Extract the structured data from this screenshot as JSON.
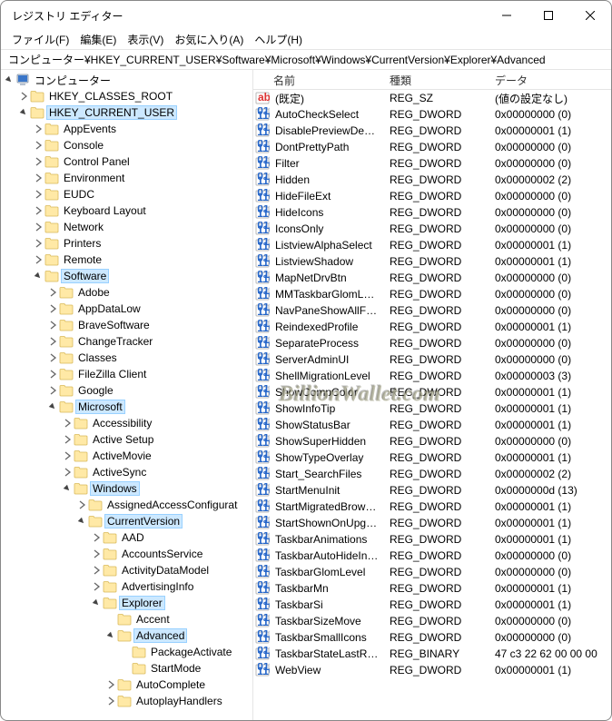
{
  "window": {
    "title": "レジストリ エディター"
  },
  "menu": {
    "file": "ファイル(F)",
    "edit": "編集(E)",
    "view": "表示(V)",
    "favorites": "お気に入り(A)",
    "help": "ヘルプ(H)"
  },
  "address": {
    "path": "コンピューター¥HKEY_CURRENT_USER¥Software¥Microsoft¥Windows¥CurrentVersion¥Explorer¥Advanced"
  },
  "tree": [
    {
      "depth": 0,
      "exp": "open",
      "icon": "computer",
      "label": "コンピューター",
      "sel": false
    },
    {
      "depth": 1,
      "exp": "closed",
      "icon": "folder",
      "label": "HKEY_CLASSES_ROOT",
      "sel": false
    },
    {
      "depth": 1,
      "exp": "open",
      "icon": "folder",
      "label": "HKEY_CURRENT_USER",
      "sel": true
    },
    {
      "depth": 2,
      "exp": "closed",
      "icon": "folder",
      "label": "AppEvents",
      "sel": false
    },
    {
      "depth": 2,
      "exp": "closed",
      "icon": "folder",
      "label": "Console",
      "sel": false
    },
    {
      "depth": 2,
      "exp": "closed",
      "icon": "folder",
      "label": "Control Panel",
      "sel": false
    },
    {
      "depth": 2,
      "exp": "closed",
      "icon": "folder",
      "label": "Environment",
      "sel": false
    },
    {
      "depth": 2,
      "exp": "closed",
      "icon": "folder",
      "label": "EUDC",
      "sel": false
    },
    {
      "depth": 2,
      "exp": "closed",
      "icon": "folder",
      "label": "Keyboard Layout",
      "sel": false
    },
    {
      "depth": 2,
      "exp": "closed",
      "icon": "folder",
      "label": "Network",
      "sel": false
    },
    {
      "depth": 2,
      "exp": "closed",
      "icon": "folder",
      "label": "Printers",
      "sel": false
    },
    {
      "depth": 2,
      "exp": "closed",
      "icon": "folder",
      "label": "Remote",
      "sel": false
    },
    {
      "depth": 2,
      "exp": "open",
      "icon": "folder-open",
      "label": "Software",
      "sel": true
    },
    {
      "depth": 3,
      "exp": "closed",
      "icon": "folder",
      "label": "Adobe",
      "sel": false
    },
    {
      "depth": 3,
      "exp": "closed",
      "icon": "folder",
      "label": "AppDataLow",
      "sel": false
    },
    {
      "depth": 3,
      "exp": "closed",
      "icon": "folder",
      "label": "BraveSoftware",
      "sel": false
    },
    {
      "depth": 3,
      "exp": "closed",
      "icon": "folder",
      "label": "ChangeTracker",
      "sel": false
    },
    {
      "depth": 3,
      "exp": "closed",
      "icon": "folder",
      "label": "Classes",
      "sel": false
    },
    {
      "depth": 3,
      "exp": "closed",
      "icon": "folder",
      "label": "FileZilla Client",
      "sel": false
    },
    {
      "depth": 3,
      "exp": "closed",
      "icon": "folder",
      "label": "Google",
      "sel": false
    },
    {
      "depth": 3,
      "exp": "open",
      "icon": "folder-open",
      "label": "Microsoft",
      "sel": true
    },
    {
      "depth": 4,
      "exp": "closed",
      "icon": "folder",
      "label": "Accessibility",
      "sel": false
    },
    {
      "depth": 4,
      "exp": "closed",
      "icon": "folder",
      "label": "Active Setup",
      "sel": false
    },
    {
      "depth": 4,
      "exp": "closed",
      "icon": "folder",
      "label": "ActiveMovie",
      "sel": false
    },
    {
      "depth": 4,
      "exp": "closed",
      "icon": "folder",
      "label": "ActiveSync",
      "sel": false
    },
    {
      "depth": 4,
      "exp": "open",
      "icon": "folder-open",
      "label": "Windows",
      "sel": true
    },
    {
      "depth": 5,
      "exp": "closed",
      "icon": "folder",
      "label": "AssignedAccessConfigurat",
      "sel": false
    },
    {
      "depth": 5,
      "exp": "open",
      "icon": "folder-open",
      "label": "CurrentVersion",
      "sel": true
    },
    {
      "depth": 6,
      "exp": "closed",
      "icon": "folder",
      "label": "AAD",
      "sel": false
    },
    {
      "depth": 6,
      "exp": "closed",
      "icon": "folder",
      "label": "AccountsService",
      "sel": false
    },
    {
      "depth": 6,
      "exp": "closed",
      "icon": "folder",
      "label": "ActivityDataModel",
      "sel": false
    },
    {
      "depth": 6,
      "exp": "closed",
      "icon": "folder",
      "label": "AdvertisingInfo",
      "sel": false
    },
    {
      "depth": 6,
      "exp": "open",
      "icon": "folder-open",
      "label": "Explorer",
      "sel": true
    },
    {
      "depth": 7,
      "exp": "none",
      "icon": "folder",
      "label": "Accent",
      "sel": false
    },
    {
      "depth": 7,
      "exp": "open",
      "icon": "folder-open",
      "label": "Advanced",
      "sel": true
    },
    {
      "depth": 8,
      "exp": "none",
      "icon": "folder",
      "label": "PackageActivate",
      "sel": false
    },
    {
      "depth": 8,
      "exp": "none",
      "icon": "folder",
      "label": "StartMode",
      "sel": false
    },
    {
      "depth": 7,
      "exp": "closed",
      "icon": "folder",
      "label": "AutoComplete",
      "sel": false
    },
    {
      "depth": 7,
      "exp": "closed",
      "icon": "folder",
      "label": "AutoplayHandlers",
      "sel": false
    }
  ],
  "columns": {
    "name": "名前",
    "type": "種類",
    "data": "データ"
  },
  "values": [
    {
      "icon": "str",
      "name": "(既定)",
      "type": "REG_SZ",
      "data": "(値の設定なし)"
    },
    {
      "icon": "bin",
      "name": "AutoCheckSelect",
      "type": "REG_DWORD",
      "data": "0x00000000 (0)"
    },
    {
      "icon": "bin",
      "name": "DisablePreviewDesktop",
      "type": "REG_DWORD",
      "data": "0x00000001 (1)"
    },
    {
      "icon": "bin",
      "name": "DontPrettyPath",
      "type": "REG_DWORD",
      "data": "0x00000000 (0)"
    },
    {
      "icon": "bin",
      "name": "Filter",
      "type": "REG_DWORD",
      "data": "0x00000000 (0)"
    },
    {
      "icon": "bin",
      "name": "Hidden",
      "type": "REG_DWORD",
      "data": "0x00000002 (2)"
    },
    {
      "icon": "bin",
      "name": "HideFileExt",
      "type": "REG_DWORD",
      "data": "0x00000000 (0)"
    },
    {
      "icon": "bin",
      "name": "HideIcons",
      "type": "REG_DWORD",
      "data": "0x00000000 (0)"
    },
    {
      "icon": "bin",
      "name": "IconsOnly",
      "type": "REG_DWORD",
      "data": "0x00000000 (0)"
    },
    {
      "icon": "bin",
      "name": "ListviewAlphaSelect",
      "type": "REG_DWORD",
      "data": "0x00000001 (1)"
    },
    {
      "icon": "bin",
      "name": "ListviewShadow",
      "type": "REG_DWORD",
      "data": "0x00000001 (1)"
    },
    {
      "icon": "bin",
      "name": "MapNetDrvBtn",
      "type": "REG_DWORD",
      "data": "0x00000000 (0)"
    },
    {
      "icon": "bin",
      "name": "MMTaskbarGlomLevel",
      "type": "REG_DWORD",
      "data": "0x00000000 (0)"
    },
    {
      "icon": "bin",
      "name": "NavPaneShowAllFold...",
      "type": "REG_DWORD",
      "data": "0x00000000 (0)"
    },
    {
      "icon": "bin",
      "name": "ReindexedProfile",
      "type": "REG_DWORD",
      "data": "0x00000001 (1)"
    },
    {
      "icon": "bin",
      "name": "SeparateProcess",
      "type": "REG_DWORD",
      "data": "0x00000000 (0)"
    },
    {
      "icon": "bin",
      "name": "ServerAdminUI",
      "type": "REG_DWORD",
      "data": "0x00000000 (0)"
    },
    {
      "icon": "bin",
      "name": "ShellMigrationLevel",
      "type": "REG_DWORD",
      "data": "0x00000003 (3)"
    },
    {
      "icon": "bin",
      "name": "ShowCompColor",
      "type": "REG_DWORD",
      "data": "0x00000001 (1)"
    },
    {
      "icon": "bin",
      "name": "ShowInfoTip",
      "type": "REG_DWORD",
      "data": "0x00000001 (1)"
    },
    {
      "icon": "bin",
      "name": "ShowStatusBar",
      "type": "REG_DWORD",
      "data": "0x00000001 (1)"
    },
    {
      "icon": "bin",
      "name": "ShowSuperHidden",
      "type": "REG_DWORD",
      "data": "0x00000000 (0)"
    },
    {
      "icon": "bin",
      "name": "ShowTypeOverlay",
      "type": "REG_DWORD",
      "data": "0x00000001 (1)"
    },
    {
      "icon": "bin",
      "name": "Start_SearchFiles",
      "type": "REG_DWORD",
      "data": "0x00000002 (2)"
    },
    {
      "icon": "bin",
      "name": "StartMenuInit",
      "type": "REG_DWORD",
      "data": "0x0000000d (13)"
    },
    {
      "icon": "bin",
      "name": "StartMigratedBrowser...",
      "type": "REG_DWORD",
      "data": "0x00000001 (1)"
    },
    {
      "icon": "bin",
      "name": "StartShownOnUpgrade",
      "type": "REG_DWORD",
      "data": "0x00000001 (1)"
    },
    {
      "icon": "bin",
      "name": "TaskbarAnimations",
      "type": "REG_DWORD",
      "data": "0x00000001 (1)"
    },
    {
      "icon": "bin",
      "name": "TaskbarAutoHideInTa...",
      "type": "REG_DWORD",
      "data": "0x00000000 (0)"
    },
    {
      "icon": "bin",
      "name": "TaskbarGlomLevel",
      "type": "REG_DWORD",
      "data": "0x00000000 (0)"
    },
    {
      "icon": "bin",
      "name": "TaskbarMn",
      "type": "REG_DWORD",
      "data": "0x00000001 (1)"
    },
    {
      "icon": "bin",
      "name": "TaskbarSi",
      "type": "REG_DWORD",
      "data": "0x00000001 (1)"
    },
    {
      "icon": "bin",
      "name": "TaskbarSizeMove",
      "type": "REG_DWORD",
      "data": "0x00000000 (0)"
    },
    {
      "icon": "bin",
      "name": "TaskbarSmallIcons",
      "type": "REG_DWORD",
      "data": "0x00000000 (0)"
    },
    {
      "icon": "bin",
      "name": "TaskbarStateLastRun",
      "type": "REG_BINARY",
      "data": "47 c3 22 62 00 00 00"
    },
    {
      "icon": "bin",
      "name": "WebView",
      "type": "REG_DWORD",
      "data": "0x00000001 (1)"
    }
  ],
  "watermark": "BillionWallet.com"
}
